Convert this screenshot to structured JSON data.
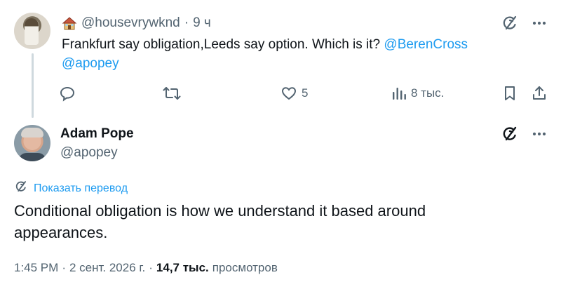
{
  "parent_tweet": {
    "author_emoji": "house-icon",
    "handle": "@housevrywknd",
    "separator": "·",
    "time": "9 ч",
    "text_main": "Frankfurt say obligation,Leeds say option. Which is it? ",
    "mention1": "@BerenCross",
    "mention2": "@apopey",
    "actions": {
      "reply": {
        "icon": "reply-icon",
        "count": ""
      },
      "retweet": {
        "icon": "retweet-icon",
        "count": ""
      },
      "like": {
        "icon": "heart-icon",
        "count": "5"
      },
      "views": {
        "icon": "views-icon",
        "count": "8 тыс."
      },
      "bookmark": {
        "icon": "bookmark-icon"
      },
      "share": {
        "icon": "share-icon"
      }
    },
    "top_icons": [
      "grok-icon",
      "more-icon"
    ]
  },
  "main_tweet": {
    "name": "Adam Pope",
    "handle": "@apopey",
    "translate_label": "Показать перевод",
    "text": "Conditional obligation is how we understand it based around appearances.",
    "meta": {
      "time": "1:45 PM",
      "sep1": "·",
      "date": "2 сент. 2026 г.",
      "sep2": "·",
      "views_count": "14,7 тыс.",
      "views_label": "просмотров"
    },
    "top_icons": [
      "grok-icon",
      "more-icon"
    ]
  },
  "colors": {
    "accent": "#1d9bf0",
    "secondary_text": "#536471",
    "primary_text": "#0f1419",
    "thread_line": "#cfd9de"
  }
}
